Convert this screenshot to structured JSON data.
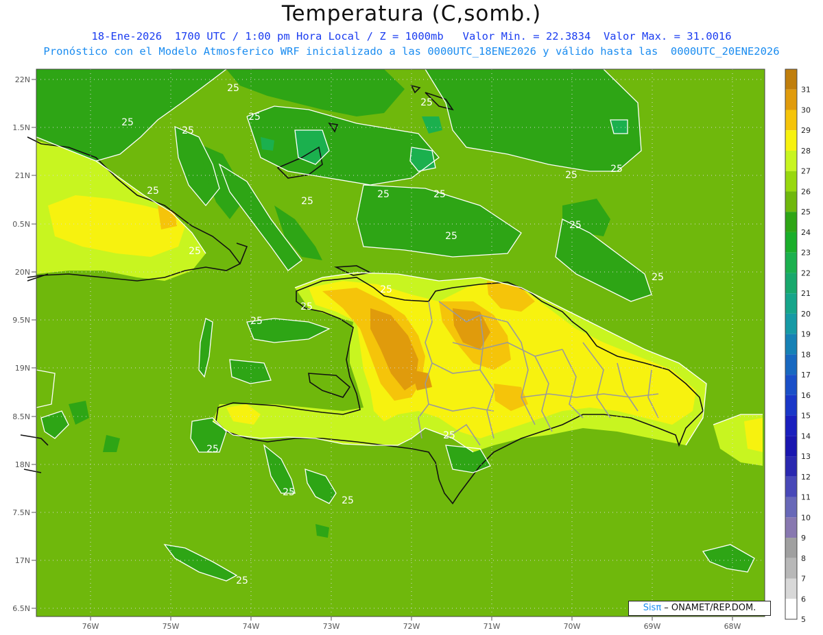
{
  "title": "Temperatura (C,somb.)",
  "subtitle_line1": "18-Ene-2026  1700 UTC / 1:00 pm Hora Local / Z = 1000mb   Valor Min. = 22.3834  Valor Max. = 31.0016",
  "subtitle_line2": "Pronóstico con el Modelo Atmosferico WRF inicializado a las 0000UTC_18ENE2026 y válido hasta las  0000UTC_20ENE2026",
  "credit": {
    "brand": "Sisπ",
    "text": " – ONAMET/REP.DOM."
  },
  "map": {
    "lat_ticks": [
      "22N",
      "1.5N",
      "21N",
      "0.5N",
      "20N",
      "9.5N",
      "19N",
      "8.5N",
      "18N",
      "7.5N",
      "17N",
      "6.5N"
    ],
    "lon_ticks": [
      "76W",
      "75W",
      "74W",
      "73W",
      "72W",
      "71W",
      "70W",
      "69W",
      "68W"
    ],
    "contour_labels": [
      "25",
      "25",
      "25",
      "25",
      "25",
      "25",
      "25",
      "25",
      "25",
      "25",
      "25",
      "25",
      "25",
      "25",
      "25",
      "25",
      "25",
      "25",
      "25",
      "25",
      "25",
      "25",
      "25"
    ]
  },
  "colorbar": {
    "levels": [
      "31",
      "30",
      "29",
      "28",
      "27",
      "26",
      "25",
      "24",
      "23",
      "22",
      "21",
      "20",
      "19",
      "18",
      "17",
      "16",
      "15",
      "14",
      "13",
      "12",
      "11",
      "10",
      "9",
      "8",
      "7",
      "6",
      "5"
    ],
    "colors": [
      "#c07e0c",
      "#e09b0c",
      "#f5c40a",
      "#f7f20f",
      "#c8f520",
      "#98d80e",
      "#6fb80c",
      "#2ea515",
      "#1aae2a",
      "#1bb04e",
      "#18a86c",
      "#16a58a",
      "#169aa5",
      "#1681b5",
      "#1868c0",
      "#1a4fc8",
      "#1a37c8",
      "#1a1fbe",
      "#1a16b0",
      "#2a28b0",
      "#4848b8",
      "#6868b8",
      "#8878b0",
      "#a0a0a0",
      "#b8b8b8",
      "#d8d8d8",
      "#ffffff"
    ]
  },
  "colors": {
    "sea_base": "#6fb80c",
    "ocean_cool": "#2ea515",
    "land_warm": "#c8f520",
    "land_hot": "#f7f20f",
    "land_hotter": "#f5c40a",
    "land_hottest": "#e09b0c"
  }
}
